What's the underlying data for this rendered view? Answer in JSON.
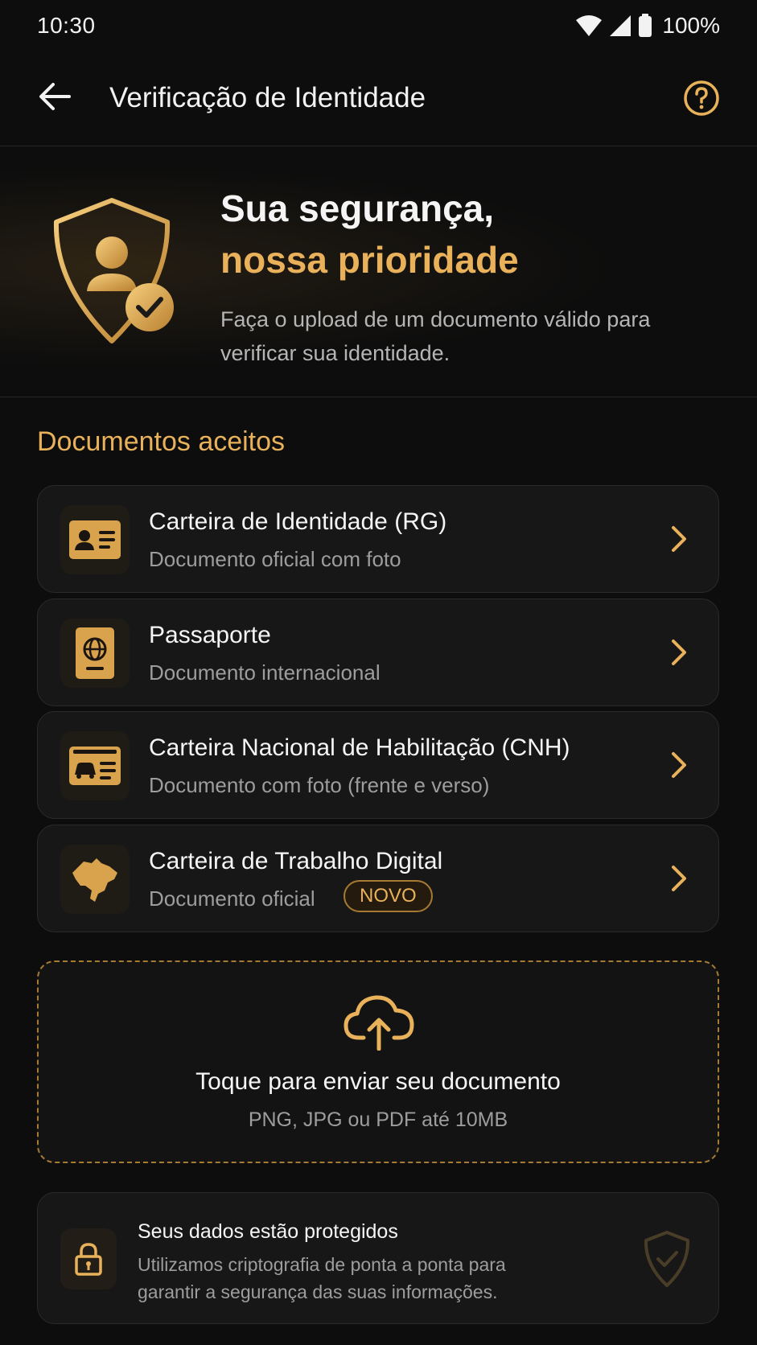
{
  "status_bar": {
    "time": "10:30",
    "battery": "100%",
    "icons": [
      "wifi-icon",
      "cellular-signal-icon",
      "battery-icon"
    ]
  },
  "app_bar": {
    "title": "Verificação de Identidade",
    "back_icon": "arrow-left-icon",
    "help_icon": "help-circle-icon"
  },
  "hero": {
    "title": "Sua segurança,",
    "title_accent": "nossa prioridade",
    "description": "Faça o upload de um documento válido para verificar sua identidade.",
    "icon": "shield-user-check-icon"
  },
  "documents": {
    "section_title": "Documentos aceitos",
    "items": [
      {
        "title": "Carteira de Identidade (RG)",
        "subtitle": "Documento oficial com foto",
        "icon": "id-card-icon"
      },
      {
        "title": "Passaporte",
        "subtitle": "Documento internacional",
        "icon": "passport-icon"
      },
      {
        "title": "Carteira Nacional de Habilitação (CNH)",
        "subtitle": "Documento com foto (frente e verso)",
        "icon": "driver-license-icon"
      },
      {
        "title": "Carteira de Trabalho Digital",
        "subtitle": "Documento oficial",
        "badge": "NOVO",
        "icon": "brazil-map-icon"
      }
    ]
  },
  "upload": {
    "title": "Toque para enviar seu documento",
    "subtitle": "PNG, JPG ou PDF até 10MB",
    "icon": "cloud-upload-icon"
  },
  "security": {
    "title": "Seus dados estão protegidos",
    "description": "Utilizamos criptografia de ponta a ponta para garantir a segurança das suas informações.",
    "icon": "lock-icon"
  },
  "colors": {
    "accent": "#e8b15a",
    "background": "#0d0d0d",
    "card": "#171717"
  }
}
